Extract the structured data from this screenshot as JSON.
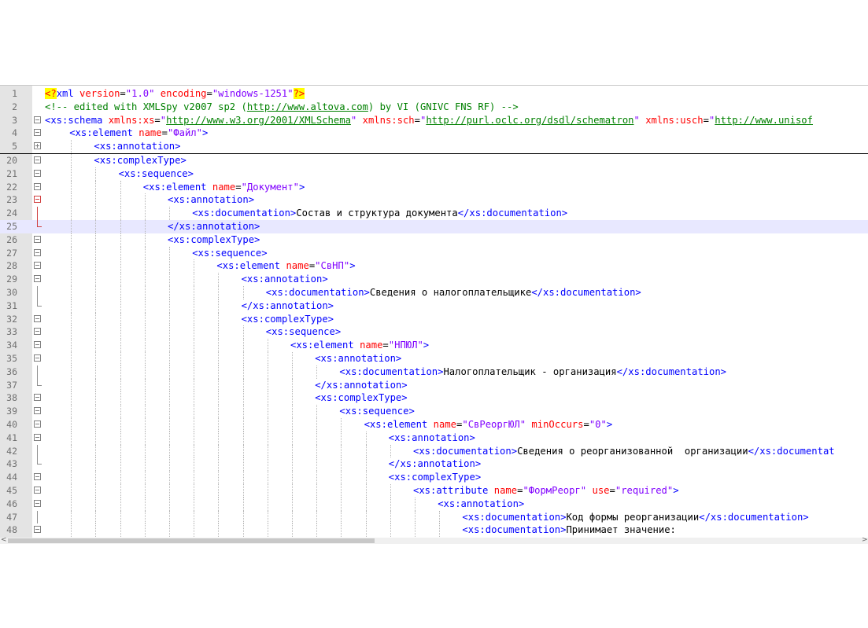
{
  "editor": {
    "lines": [
      {
        "n": "1",
        "fold": "",
        "indent": 0,
        "segs": [
          [
            "pi",
            "<?"
          ],
          [
            "tag",
            "xml "
          ],
          [
            "attr",
            "version"
          ],
          [
            "txt",
            "="
          ],
          [
            "val",
            "\"1.0\""
          ],
          [
            "txt",
            " "
          ],
          [
            "attr",
            "encoding"
          ],
          [
            "txt",
            "="
          ],
          [
            "val",
            "\"windows-1251\""
          ],
          [
            "pi",
            "?>"
          ]
        ]
      },
      {
        "n": "2",
        "fold": "",
        "indent": 0,
        "segs": [
          [
            "comment",
            "<!-- edited with XMLSpy v2007 sp2 ("
          ],
          [
            "link",
            "http://www.altova.com"
          ],
          [
            "comment",
            ") by VI (GNIVC FNS RF) -->"
          ]
        ]
      },
      {
        "n": "3",
        "fold": "minus",
        "indent": 0,
        "segs": [
          [
            "tag",
            "<xs:schema "
          ],
          [
            "attr",
            "xmlns:xs"
          ],
          [
            "txt",
            "="
          ],
          [
            "val",
            "\""
          ],
          [
            "link",
            "http://www.w3.org/2001/XMLSchema"
          ],
          [
            "val",
            "\""
          ],
          [
            "txt",
            " "
          ],
          [
            "attr",
            "xmlns:sch"
          ],
          [
            "txt",
            "="
          ],
          [
            "val",
            "\""
          ],
          [
            "link",
            "http://purl.oclc.org/dsdl/schematron"
          ],
          [
            "val",
            "\""
          ],
          [
            "txt",
            " "
          ],
          [
            "attr",
            "xmlns:usch"
          ],
          [
            "txt",
            "="
          ],
          [
            "val",
            "\""
          ],
          [
            "link",
            "http://www.unisof"
          ]
        ]
      },
      {
        "n": "4",
        "fold": "minus",
        "indent": 1,
        "segs": [
          [
            "tag",
            "<xs:element "
          ],
          [
            "attr",
            "name"
          ],
          [
            "txt",
            "="
          ],
          [
            "val",
            "\"Файл\""
          ],
          [
            "tag",
            ">"
          ]
        ]
      },
      {
        "n": "5",
        "fold": "plus",
        "indent": 2,
        "segs": [
          [
            "tag",
            "<xs:annotation>"
          ]
        ],
        "separator": true
      },
      {
        "n": "20",
        "fold": "minus",
        "indent": 2,
        "segs": [
          [
            "tag",
            "<xs:complexType>"
          ]
        ]
      },
      {
        "n": "21",
        "fold": "minus",
        "indent": 3,
        "segs": [
          [
            "tag",
            "<xs:sequence>"
          ]
        ]
      },
      {
        "n": "22",
        "fold": "minus",
        "indent": 4,
        "segs": [
          [
            "tag",
            "<xs:element "
          ],
          [
            "attr",
            "name"
          ],
          [
            "txt",
            "="
          ],
          [
            "val",
            "\"Документ\""
          ],
          [
            "tag",
            ">"
          ]
        ]
      },
      {
        "n": "23",
        "fold": "minus-red",
        "indent": 5,
        "segs": [
          [
            "tag",
            "<xs:annotation>"
          ]
        ]
      },
      {
        "n": "24",
        "fold": "line-red",
        "indent": 6,
        "segs": [
          [
            "tag",
            "<xs:documentation>"
          ],
          [
            "txt",
            "Состав и структура документа"
          ],
          [
            "tag",
            "</xs:documentation>"
          ]
        ]
      },
      {
        "n": "25",
        "fold": "end-red",
        "indent": 5,
        "segs": [
          [
            "tag",
            "</xs:annotation>"
          ]
        ],
        "current": true
      },
      {
        "n": "26",
        "fold": "minus",
        "indent": 5,
        "segs": [
          [
            "tag",
            "<xs:complexType>"
          ]
        ]
      },
      {
        "n": "27",
        "fold": "minus",
        "indent": 6,
        "segs": [
          [
            "tag",
            "<xs:sequence>"
          ]
        ]
      },
      {
        "n": "28",
        "fold": "minus",
        "indent": 7,
        "segs": [
          [
            "tag",
            "<xs:element "
          ],
          [
            "attr",
            "name"
          ],
          [
            "txt",
            "="
          ],
          [
            "val",
            "\"СвНП\""
          ],
          [
            "tag",
            ">"
          ]
        ]
      },
      {
        "n": "29",
        "fold": "minus",
        "indent": 8,
        "segs": [
          [
            "tag",
            "<xs:annotation>"
          ]
        ]
      },
      {
        "n": "30",
        "fold": "line",
        "indent": 9,
        "segs": [
          [
            "tag",
            "<xs:documentation>"
          ],
          [
            "txt",
            "Сведения о налогоплательщике"
          ],
          [
            "tag",
            "</xs:documentation>"
          ]
        ]
      },
      {
        "n": "31",
        "fold": "end",
        "indent": 8,
        "segs": [
          [
            "tag",
            "</xs:annotation>"
          ]
        ]
      },
      {
        "n": "32",
        "fold": "minus",
        "indent": 8,
        "segs": [
          [
            "tag",
            "<xs:complexType>"
          ]
        ]
      },
      {
        "n": "33",
        "fold": "minus",
        "indent": 9,
        "segs": [
          [
            "tag",
            "<xs:sequence>"
          ]
        ]
      },
      {
        "n": "34",
        "fold": "minus",
        "indent": 10,
        "segs": [
          [
            "tag",
            "<xs:element "
          ],
          [
            "attr",
            "name"
          ],
          [
            "txt",
            "="
          ],
          [
            "val",
            "\"НПЮЛ\""
          ],
          [
            "tag",
            ">"
          ]
        ]
      },
      {
        "n": "35",
        "fold": "minus",
        "indent": 11,
        "segs": [
          [
            "tag",
            "<xs:annotation>"
          ]
        ]
      },
      {
        "n": "36",
        "fold": "line",
        "indent": 12,
        "segs": [
          [
            "tag",
            "<xs:documentation>"
          ],
          [
            "txt",
            "Налогоплательщик - организация"
          ],
          [
            "tag",
            "</xs:documentation>"
          ]
        ]
      },
      {
        "n": "37",
        "fold": "end",
        "indent": 11,
        "segs": [
          [
            "tag",
            "</xs:annotation>"
          ]
        ]
      },
      {
        "n": "38",
        "fold": "minus",
        "indent": 11,
        "segs": [
          [
            "tag",
            "<xs:complexType>"
          ]
        ]
      },
      {
        "n": "39",
        "fold": "minus",
        "indent": 12,
        "segs": [
          [
            "tag",
            "<xs:sequence>"
          ]
        ]
      },
      {
        "n": "40",
        "fold": "minus",
        "indent": 13,
        "segs": [
          [
            "tag",
            "<xs:element "
          ],
          [
            "attr",
            "name"
          ],
          [
            "txt",
            "="
          ],
          [
            "val",
            "\"СвРеоргЮЛ\""
          ],
          [
            "txt",
            " "
          ],
          [
            "attr",
            "minOccurs"
          ],
          [
            "txt",
            "="
          ],
          [
            "val",
            "\"0\""
          ],
          [
            "tag",
            ">"
          ]
        ]
      },
      {
        "n": "41",
        "fold": "minus",
        "indent": 14,
        "segs": [
          [
            "tag",
            "<xs:annotation>"
          ]
        ]
      },
      {
        "n": "42",
        "fold": "line",
        "indent": 15,
        "segs": [
          [
            "tag",
            "<xs:documentation>"
          ],
          [
            "txt",
            "Сведения о реорганизованной  организации"
          ],
          [
            "tag",
            "</xs:documentat"
          ]
        ]
      },
      {
        "n": "43",
        "fold": "end",
        "indent": 14,
        "segs": [
          [
            "tag",
            "</xs:annotation>"
          ]
        ]
      },
      {
        "n": "44",
        "fold": "minus",
        "indent": 14,
        "segs": [
          [
            "tag",
            "<xs:complexType>"
          ]
        ]
      },
      {
        "n": "45",
        "fold": "minus",
        "indent": 15,
        "segs": [
          [
            "tag",
            "<xs:attribute "
          ],
          [
            "attr",
            "name"
          ],
          [
            "txt",
            "="
          ],
          [
            "val",
            "\"ФормРеорг\""
          ],
          [
            "txt",
            " "
          ],
          [
            "attr",
            "use"
          ],
          [
            "txt",
            "="
          ],
          [
            "val",
            "\"required\""
          ],
          [
            "tag",
            ">"
          ]
        ]
      },
      {
        "n": "46",
        "fold": "minus",
        "indent": 16,
        "segs": [
          [
            "tag",
            "<xs:annotation>"
          ]
        ]
      },
      {
        "n": "47",
        "fold": "line",
        "indent": 17,
        "segs": [
          [
            "tag",
            "<xs:documentation>"
          ],
          [
            "txt",
            "Код формы реорганизации"
          ],
          [
            "tag",
            "</xs:documentation>"
          ]
        ]
      },
      {
        "n": "48",
        "fold": "minus",
        "indent": 17,
        "segs": [
          [
            "tag",
            "<xs:documentation>"
          ],
          [
            "txt",
            "Принимает значение:"
          ]
        ]
      }
    ]
  },
  "scrollbar": {
    "left_arrow": "<",
    "right_arrow": ">"
  }
}
